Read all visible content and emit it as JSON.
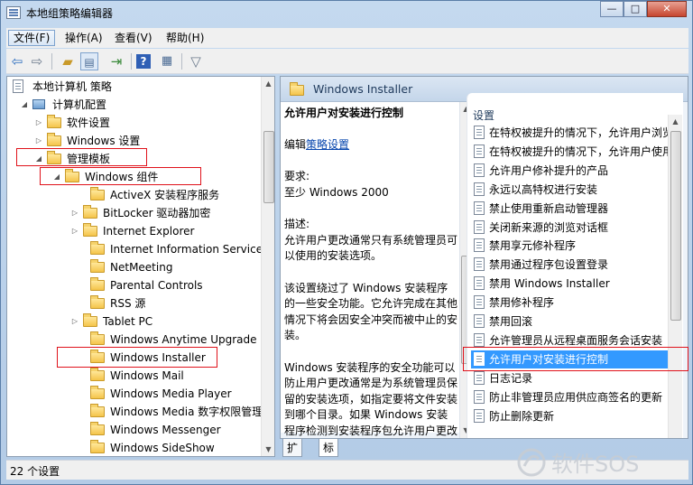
{
  "window": {
    "title": "本地组策略编辑器",
    "min": "—",
    "max": "□",
    "close": "✕"
  },
  "menu": [
    "文件(F)",
    "操作(A)",
    "查看(V)",
    "帮助(H)"
  ],
  "toolbar_icons": [
    "back-arrow-icon",
    "forward-arrow-icon",
    "up-folder-icon",
    "show-hide-tree-icon",
    "export-list-icon",
    "help-icon",
    "properties-icon",
    "filter-icon"
  ],
  "tree": [
    {
      "label": "本地计算机 策略",
      "arrow": "",
      "icon": "doc"
    },
    {
      "label": "计算机配置",
      "arrow": "◢",
      "icon": "computer"
    },
    {
      "label": "软件设置",
      "arrow": "▷",
      "icon": "folder"
    },
    {
      "label": "Windows 设置",
      "arrow": "▷",
      "icon": "folder"
    },
    {
      "label": "管理模板",
      "arrow": "◢",
      "icon": "folder"
    },
    {
      "label": "Windows 组件",
      "arrow": "◢",
      "icon": "folder"
    },
    {
      "label": "ActiveX 安装程序服务",
      "arrow": "",
      "icon": "folder"
    },
    {
      "label": "BitLocker 驱动器加密",
      "arrow": "▷",
      "icon": "folder"
    },
    {
      "label": "Internet Explorer",
      "arrow": "▷",
      "icon": "folder"
    },
    {
      "label": "Internet Information Services",
      "arrow": "",
      "icon": "folder"
    },
    {
      "label": "NetMeeting",
      "arrow": "",
      "icon": "folder"
    },
    {
      "label": "Parental Controls",
      "arrow": "",
      "icon": "folder"
    },
    {
      "label": "RSS 源",
      "arrow": "",
      "icon": "folder"
    },
    {
      "label": "Tablet PC",
      "arrow": "▷",
      "icon": "folder"
    },
    {
      "label": "Windows Anytime Upgrade",
      "arrow": "",
      "icon": "folder"
    },
    {
      "label": "Windows Installer",
      "arrow": "",
      "icon": "folder"
    },
    {
      "label": "Windows Mail",
      "arrow": "",
      "icon": "folder"
    },
    {
      "label": "Windows Media Player",
      "arrow": "",
      "icon": "folder"
    },
    {
      "label": "Windows Media 数字权限管理",
      "arrow": "",
      "icon": "folder"
    },
    {
      "label": "Windows Messenger",
      "arrow": "",
      "icon": "folder"
    },
    {
      "label": "Windows SideShow",
      "arrow": "",
      "icon": "folder"
    }
  ],
  "right_header": "Windows Installer",
  "description": {
    "title": "允许用户对安装进行控制",
    "edit_prefix": "编辑",
    "edit_link": "策略设置",
    "requirement_label": "要求:",
    "requirement_value": "至少 Windows 2000",
    "desc_label": "描述:",
    "desc_p1": "允许用户更改通常只有系统管理员可以使用的安装选项。",
    "desc_p2": "该设置绕过了 Windows 安装程序的一些安全功能。它允许完成在其他情况下将会因安全冲突而被中止的安装。",
    "desc_p3": "Windows 安装程序的安全功能可以防止用户更改通常是为系统管理员保留的安装选项，如指定要将文件安装到哪个目录。如果 Windows 安装程序检测到安装程序包允许用户更改受保护的选项"
  },
  "list_header": "设置",
  "settings": [
    "在特权被提升的情况下，允许用户浏览",
    "在特权被提升的情况下，允许用户使用",
    "允许用户修补提升的产品",
    "永远以高特权进行安装",
    "禁止使用重新启动管理器",
    "关闭新来源的浏览对话框",
    "禁用享元修补程序",
    "禁用通过程序包设置登录",
    "禁用 Windows Installer",
    "禁用修补程序",
    "禁用回滚",
    "允许管理员从远程桌面服务会话安装",
    "允许用户对安装进行控制",
    "日志记录",
    "防止非管理员应用供应商签名的更新",
    "防止删除更新"
  ],
  "selected_index": 12,
  "tabs": [
    "扩展",
    "标准"
  ],
  "status": "22 个设置",
  "watermark": "软件SOS",
  "colors": {
    "selection": "#3399ff",
    "highlight_box": "#e0121b"
  }
}
